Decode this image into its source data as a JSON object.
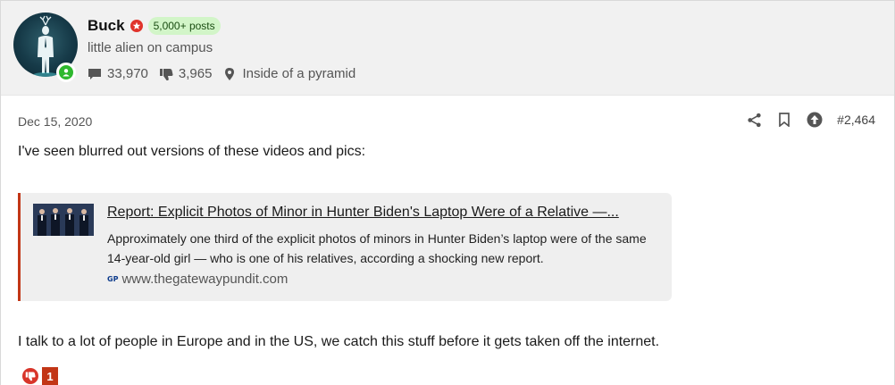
{
  "user": {
    "name": "Buck",
    "posts_badge": "5,000+ posts",
    "title": "little alien on campus",
    "replies_count": "33,970",
    "likes_count": "3,965",
    "location": "Inside of a pyramid"
  },
  "post": {
    "date": "Dec 15, 2020",
    "number": "#2,464",
    "paragraph1": "I've seen blurred out versions of these videos and pics:",
    "paragraph2": "I talk to a lot of people in Europe and in the US, we catch this stuff before it gets taken off the internet."
  },
  "onebox": {
    "title": "Report: Explicit Photos of Minor in Hunter Biden's Laptop Were of a Relative —...",
    "description": "Approximately one third of the explicit photos of minors in Hunter Biden’s laptop were of the same 14-year-old girl — who is one of his relatives, according a shocking new report.",
    "site_icon": "GP",
    "site": "www.thegatewaypundit.com",
    "accent_color": "#c23616"
  },
  "reactions": {
    "count": "1",
    "icon": "thumbs-down-icon"
  },
  "icons": {
    "stat_replies": "comment-icon",
    "stat_likes": "thumbs-down-icon",
    "stat_location": "map-pin-icon",
    "actions": [
      "share-icon",
      "bookmark-icon",
      "arrow-up-circle-icon"
    ]
  }
}
